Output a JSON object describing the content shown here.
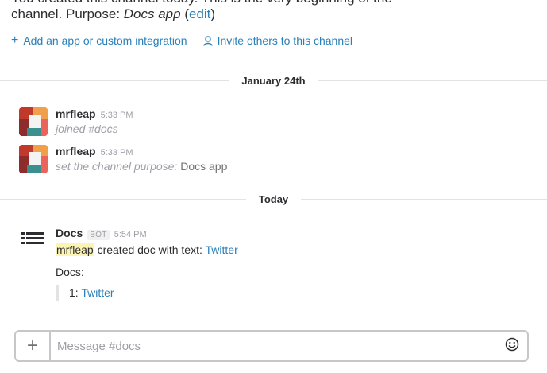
{
  "intro": {
    "top_line_cutoff": "You created this channel today. This is the very beginning of the",
    "purpose_prefix": "channel. Purpose: ",
    "purpose_value": "Docs app",
    "edit_open": " (",
    "edit_link": "edit",
    "edit_close": ")"
  },
  "actions": {
    "add_app": "Add an app or custom integration",
    "invite": "Invite others to this channel"
  },
  "dividers": {
    "first": "January 24th",
    "second": "Today"
  },
  "messages": [
    {
      "author": "mrfleap",
      "time": "5:33 PM",
      "text": "joined #docs"
    },
    {
      "author": "mrfleap",
      "time": "5:33 PM",
      "text_italic": "set the channel purpose:",
      "text_plain": " Docs app"
    },
    {
      "author": "Docs",
      "badge": "BOT",
      "time": "5:54 PM",
      "mention": "mrfleap",
      "text_mid": " created doc with text: ",
      "link": "Twitter",
      "attachment_title": "Docs:",
      "attachment_item_prefix": "1: ",
      "attachment_item_link": "Twitter"
    }
  ],
  "composer": {
    "placeholder": "Message #docs",
    "value": ""
  },
  "colors": {
    "link": "#2a80b9",
    "mention_bg": "#fcf4b3",
    "muted": "#9e9ea6"
  },
  "icons": {
    "add": "plus-icon",
    "invite": "person-icon",
    "docs": "list-icon",
    "emoji": "smiley-icon",
    "composer_add": "plus-icon"
  }
}
